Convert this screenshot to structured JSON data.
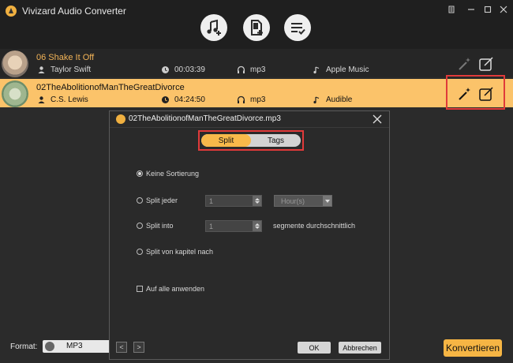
{
  "app": {
    "title": "Vivizard Audio Converter"
  },
  "toolbar": {
    "add_music_icon": "music-add-icon",
    "add_file_icon": "file-add-icon",
    "list_icon": "list-check-icon"
  },
  "files": [
    {
      "name": "06 Shake It Off",
      "artist": "Taylor Swift",
      "duration": "00:03:39",
      "format": "mp3",
      "source": "Apple Music"
    },
    {
      "name": "02TheAbolitionofManTheGreatDivorce",
      "artist": "C.S. Lewis",
      "duration": "04:24:50",
      "format": "mp3",
      "source": "Audible"
    }
  ],
  "bottom": {
    "format_label": "Format:",
    "format_value": "MP3",
    "convert_label": "Konvertieren"
  },
  "dialog": {
    "title": "02TheAbolitionofManTheGreatDivorce.mp3",
    "tabs": [
      "Split",
      "Tags"
    ],
    "active_tab": "Split",
    "options": {
      "none": "Keine Sortierung",
      "every": "Split jeder",
      "into": "Split into",
      "chapter": "Split von kapitel nach"
    },
    "every_value": "1",
    "every_unit": "Hour(s)",
    "into_value": "1",
    "into_suffix": "segmente durchschnittlich",
    "apply_all": "Auf alle anwenden",
    "prev": "<",
    "next": ">",
    "ok": "OK",
    "cancel": "Abbrechen"
  }
}
